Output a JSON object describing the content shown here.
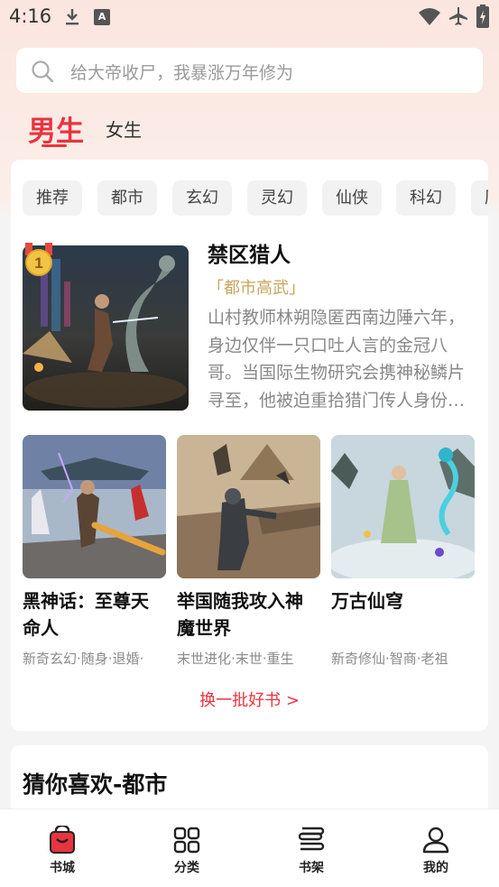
{
  "status_bar": {
    "time": "4:16",
    "a_badge": "A",
    "icons": [
      "download-icon",
      "a-badge-icon",
      "wifi-icon",
      "airplane-icon",
      "battery-icon"
    ]
  },
  "search": {
    "placeholder": "给大帝收尸，我暴涨万年修为"
  },
  "gender_tabs": {
    "male": "男生",
    "female": "女生",
    "selected": "男生"
  },
  "categories": [
    "推荐",
    "都市",
    "玄幻",
    "灵幻",
    "仙侠",
    "科幻",
    "历史"
  ],
  "featured": {
    "rank": "1",
    "title": "禁区猎人",
    "tag": "「都市高武」",
    "description": "山村教师林朔隐匿西南边陲六年，身边仅伴一只口吐人言的金冠八哥。当国际生物研究会携神秘鳞片寻至，他被迫重拾猎门传人身份…"
  },
  "books": [
    {
      "title": "黑神话：至尊天命人",
      "tags": "新奇玄幻·随身·退婚·"
    },
    {
      "title": "举国随我攻入神魔世界",
      "tags": "末世进化·末世·重生"
    },
    {
      "title": "万古仙穹",
      "tags": "新奇修仙·智商·老祖"
    }
  ],
  "refresh_label": "换一批好书 >",
  "guess_section": {
    "title": "猜你喜欢-都市"
  },
  "bottom_nav": [
    {
      "label": "书城",
      "icon": "bookstore-icon",
      "active": true
    },
    {
      "label": "分类",
      "icon": "category-grid-icon",
      "active": false
    },
    {
      "label": "书架",
      "icon": "bookshelf-icon",
      "active": false
    },
    {
      "label": "我的",
      "icon": "profile-icon",
      "active": false
    }
  ],
  "colors": {
    "accent": "#e8343f",
    "tag_gold": "#c8a45c",
    "muted": "#888888"
  }
}
